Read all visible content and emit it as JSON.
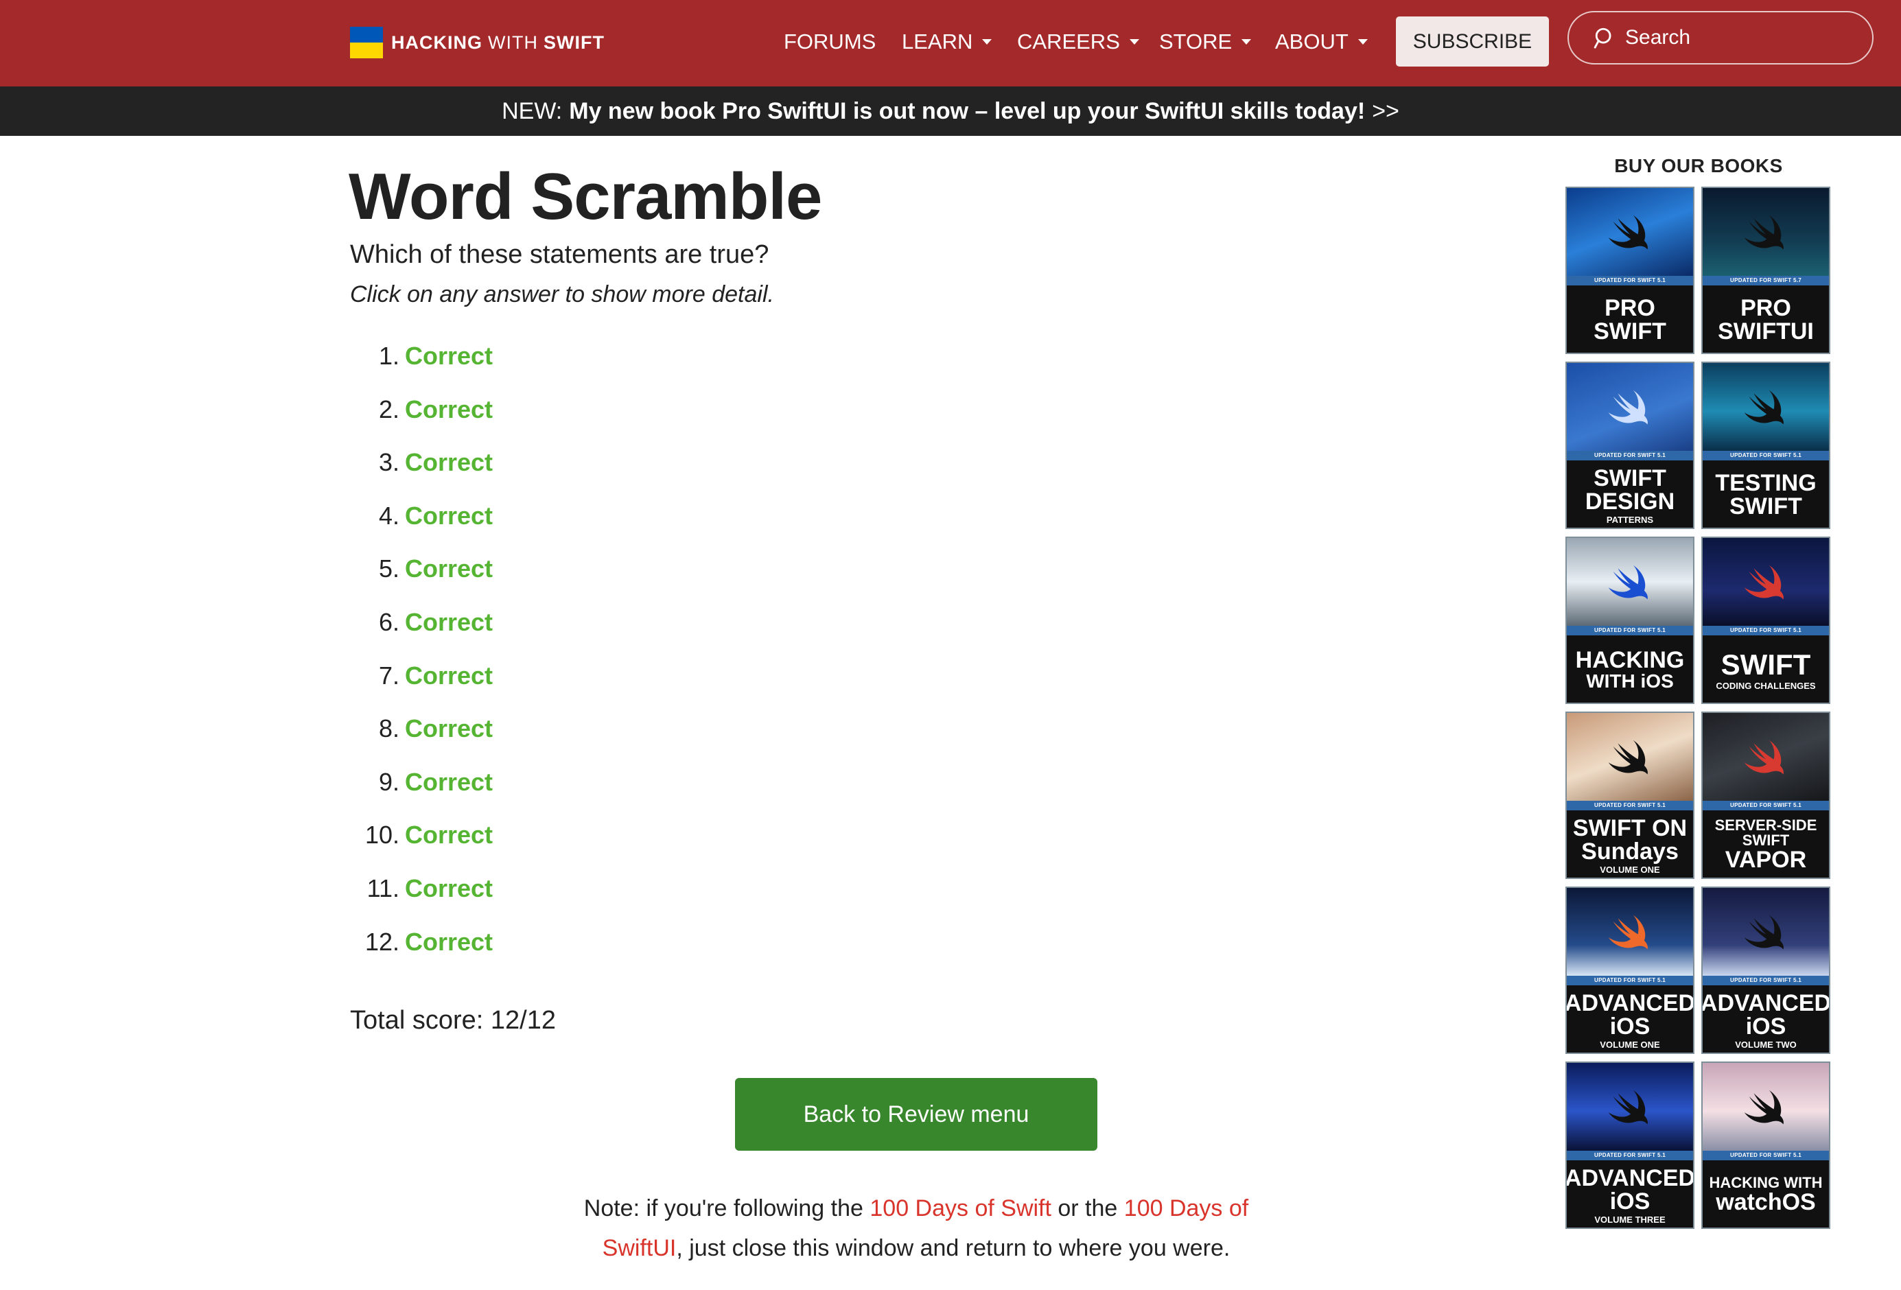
{
  "nav": {
    "brand": {
      "word1": "HACKING",
      "word2": "WITH",
      "word3": "SWIFT"
    },
    "items": [
      {
        "label": "FORUMS",
        "dropdown": false
      },
      {
        "label": "LEARN",
        "dropdown": true
      },
      {
        "label": "CAREERS",
        "dropdown": true
      },
      {
        "label": "STORE",
        "dropdown": true
      },
      {
        "label": "ABOUT",
        "dropdown": true
      }
    ],
    "subscribe_label": "SUBSCRIBE",
    "search_placeholder": "Search"
  },
  "announcement": {
    "prefix": "NEW:",
    "text": "My new book Pro SwiftUI is out now – level up your SwiftUI skills today!",
    "arrows": ">>"
  },
  "main": {
    "title": "Word Scramble",
    "question": "Which of these statements are true?",
    "hint": "Click on any answer to show more detail.",
    "answers": [
      {
        "num": "1.",
        "result": "Correct"
      },
      {
        "num": "2.",
        "result": "Correct"
      },
      {
        "num": "3.",
        "result": "Correct"
      },
      {
        "num": "4.",
        "result": "Correct"
      },
      {
        "num": "5.",
        "result": "Correct"
      },
      {
        "num": "6.",
        "result": "Correct"
      },
      {
        "num": "7.",
        "result": "Correct"
      },
      {
        "num": "8.",
        "result": "Correct"
      },
      {
        "num": "9.",
        "result": "Correct"
      },
      {
        "num": "10.",
        "result": "Correct"
      },
      {
        "num": "11.",
        "result": "Correct"
      },
      {
        "num": "12.",
        "result": "Correct"
      }
    ],
    "score": "Total score: 12/12",
    "back_button": "Back to Review menu",
    "note": {
      "part1": "Note: if you're following the ",
      "link1": "100 Days of Swift",
      "part2": " or the ",
      "link2": "100 Days of SwiftUI",
      "part3": ", just close this window and return to where you were."
    }
  },
  "sidebar": {
    "title": "BUY OUR BOOKS",
    "books": [
      {
        "band": "UPDATED FOR SWIFT 5.1",
        "line1": "PRO",
        "line2": "SWIFT",
        "small": ""
      },
      {
        "band": "UPDATED FOR SWIFT 5.7",
        "line1": "PRO",
        "line2": "SWIFTUI",
        "small": ""
      },
      {
        "band": "UPDATED FOR SWIFT 5.1",
        "line1": "SWIFT",
        "line2": "DESIGN",
        "small": "PATTERNS"
      },
      {
        "band": "UPDATED FOR SWIFT 5.1",
        "line1": "TESTING",
        "line2": "SWIFT",
        "small": ""
      },
      {
        "band": "UPDATED FOR SWIFT 5.1",
        "line1": "HACKING",
        "line2": "WITH iOS",
        "small": ""
      },
      {
        "band": "UPDATED FOR SWIFT 5.1",
        "line1": "SWIFT",
        "line2": "",
        "small": "CODING CHALLENGES"
      },
      {
        "band": "UPDATED FOR SWIFT 5.1",
        "line1": "SWIFT ON",
        "line2": "Sundays",
        "small": "VOLUME ONE"
      },
      {
        "band": "UPDATED FOR SWIFT 5.1",
        "line1": "SERVER-SIDE SWIFT",
        "line2": "VAPOR",
        "small": ""
      },
      {
        "band": "UPDATED FOR SWIFT 5.1",
        "line1": "ADVANCED",
        "line2": "iOS",
        "small": "VOLUME ONE"
      },
      {
        "band": "UPDATED FOR SWIFT 5.1",
        "line1": "ADVANCED",
        "line2": "iOS",
        "small": "VOLUME TWO"
      },
      {
        "band": "UPDATED FOR SWIFT 5.1",
        "line1": "ADVANCED",
        "line2": "iOS",
        "small": "VOLUME THREE"
      },
      {
        "band": "UPDATED FOR SWIFT 5.1",
        "line1": "HACKING WITH",
        "line2": "watchOS",
        "small": ""
      }
    ]
  },
  "colors": {
    "navbar": "#a4292b",
    "announce": "#232323",
    "correct": "#55b432",
    "back_button": "#38872d",
    "link": "#d9342b"
  }
}
